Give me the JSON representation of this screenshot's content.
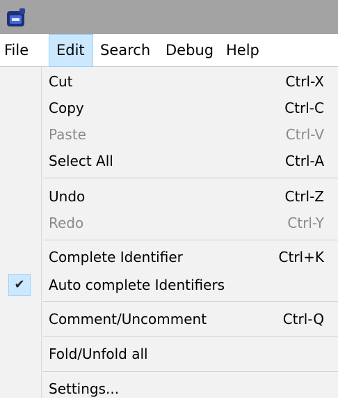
{
  "app": {
    "icon": "app-logo-icon"
  },
  "menubar": {
    "items": [
      {
        "label": "File"
      },
      {
        "label": "Edit",
        "active": true
      },
      {
        "label": "Search"
      },
      {
        "label": "Debug"
      },
      {
        "label": "Help"
      }
    ]
  },
  "edit_menu": {
    "cut": {
      "label": "Cut",
      "shortcut": "Ctrl-X"
    },
    "copy": {
      "label": "Copy",
      "shortcut": "Ctrl-C"
    },
    "paste": {
      "label": "Paste",
      "shortcut": "Ctrl-V",
      "enabled": false
    },
    "select_all": {
      "label": "Select All",
      "shortcut": "Ctrl-A"
    },
    "undo": {
      "label": "Undo",
      "shortcut": "Ctrl-Z"
    },
    "redo": {
      "label": "Redo",
      "shortcut": "Ctrl-Y",
      "enabled": false
    },
    "complete_identifier": {
      "label": "Complete Identifier",
      "shortcut": "Ctrl+K"
    },
    "auto_complete": {
      "label": "Auto complete Identifiers",
      "checked": true,
      "check_glyph": "✔"
    },
    "comment": {
      "label": "Comment/Uncomment",
      "shortcut": "Ctrl-Q"
    },
    "fold": {
      "label": "Fold/Unfold all"
    },
    "settings": {
      "label": "Settings..."
    }
  },
  "colors": {
    "titlebar": "#a3a3a3",
    "highlight": "#cce8ff",
    "highlight_border": "#99d1ff",
    "menu_bg": "#f2f2f2",
    "disabled_text": "#8a8a8a"
  }
}
